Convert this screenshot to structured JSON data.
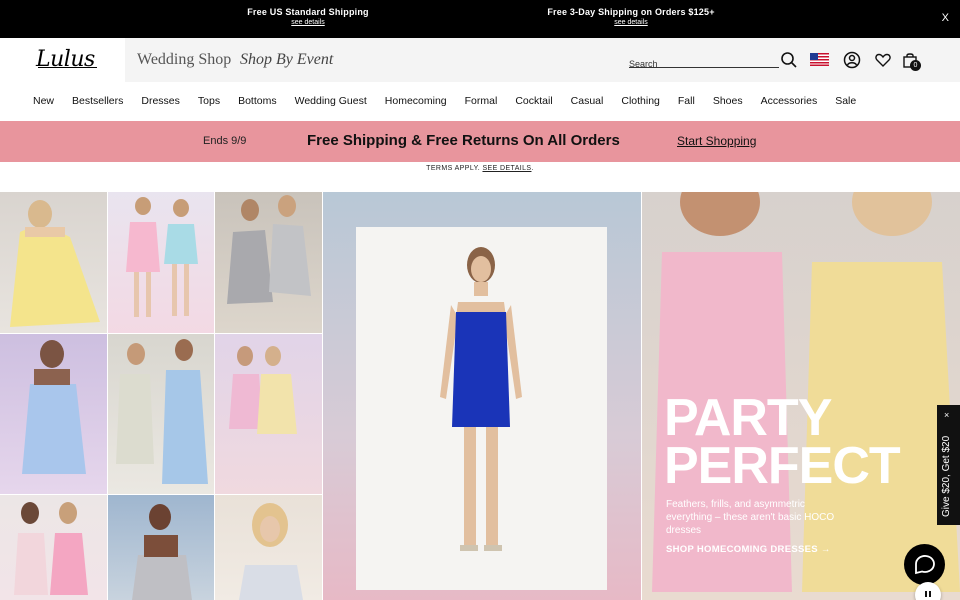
{
  "topbar": {
    "promo1_title": "Free US Standard Shipping",
    "promo1_link": "see details",
    "promo2_title": "Free 3-Day Shipping on Orders $125+",
    "promo2_link": "see details",
    "close": "X"
  },
  "header": {
    "logo": "Lulus",
    "wedding_shop": "Wedding Shop",
    "shop_by_event": "Shop By Event",
    "search_placeholder": "Search",
    "bag_count": "0"
  },
  "nav": {
    "items": [
      "New",
      "Bestsellers",
      "Dresses",
      "Tops",
      "Bottoms",
      "Wedding Guest",
      "Homecoming",
      "Formal",
      "Cocktail",
      "Casual",
      "Clothing",
      "Fall",
      "Shoes",
      "Accessories",
      "Sale"
    ]
  },
  "promo": {
    "ends": "Ends 9/9",
    "headline": "Free Shipping & Free Returns On All Orders",
    "cta": "Start Shopping",
    "terms": "TERMS APPLY.",
    "terms_link": "SEE DETAILS",
    "terms_end": "."
  },
  "hero": {
    "headline_line1": "PARTY",
    "headline_line2": "PERFECT",
    "description": "Feathers, frills, and asymmetric everything – these aren't basic HOCO dresses",
    "cta": "SHOP HOMECOMING DRESSES →"
  },
  "side_tab": {
    "label": "Give $20, Get $20",
    "close": "×"
  },
  "colors": {
    "topbar_bg": "#000000",
    "promo_band": "#e8959d",
    "accent_dress_blue": "#1a34b8"
  }
}
